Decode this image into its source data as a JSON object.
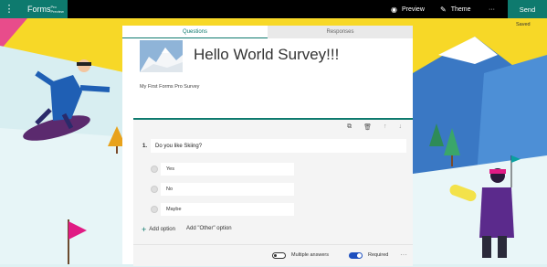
{
  "topbar": {
    "app_name": "Forms",
    "app_suffix": "Pro Preview",
    "preview_label": "Preview",
    "theme_label": "Theme",
    "more_label": "···",
    "send_label": "Send",
    "status": "Saved"
  },
  "tabs": [
    {
      "label": "Questions",
      "active": true
    },
    {
      "label": "Responses",
      "active": false
    }
  ],
  "form": {
    "title": "Hello World Survey!!!",
    "description": "My First Forms Pro Survey"
  },
  "question": {
    "number": "1.",
    "text": "Do you like Skiing?",
    "options": [
      "Yes",
      "No",
      "Maybe"
    ],
    "add_option_label": "Add option",
    "add_other_label": "Add \"Other\" option",
    "multiple_answers_label": "Multiple answers",
    "multiple_answers_on": false,
    "required_label": "Required",
    "required_on": true,
    "more_label": "···"
  },
  "theme_colors": {
    "accent": "#0e7a6e",
    "toggle_on": "#1d4fbf",
    "sky": "#f7d827"
  },
  "icons": [
    "app-launcher-icon",
    "preview-icon",
    "theme-icon",
    "copy-icon",
    "delete-icon",
    "move-up-icon",
    "move-down-icon",
    "plus-icon"
  ]
}
